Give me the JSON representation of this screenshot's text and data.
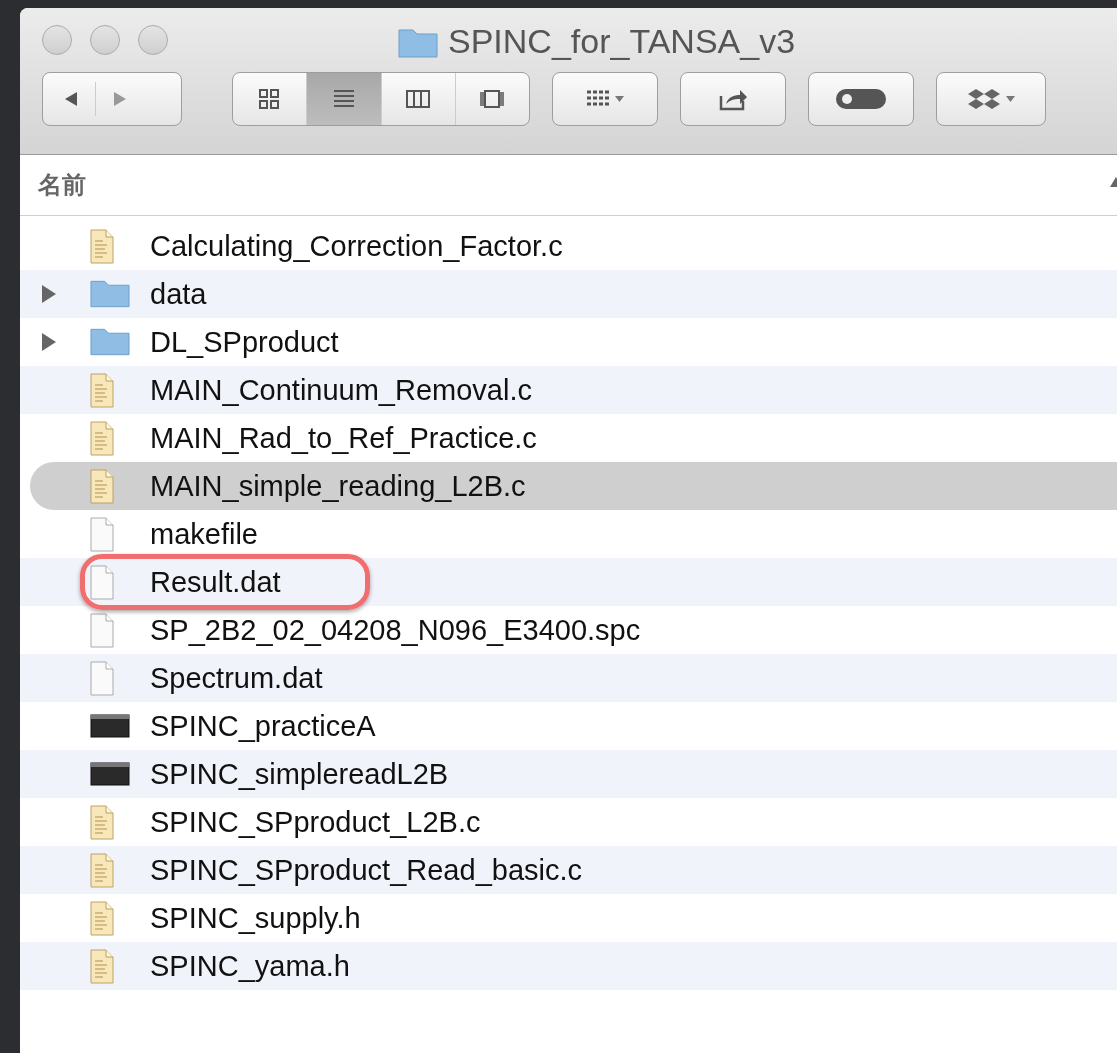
{
  "window": {
    "title": "SPINC_for_TANSA_v3"
  },
  "toolbar": {
    "view_modes": [
      {
        "kind": "icons",
        "selected": false
      },
      {
        "kind": "list",
        "selected": true
      },
      {
        "kind": "columns",
        "selected": false
      },
      {
        "kind": "coverflow",
        "selected": false
      }
    ]
  },
  "column_header": {
    "label": "名前"
  },
  "files": [
    {
      "name": "Calculating_Correction_Factor.c",
      "kind": "source",
      "selected": false
    },
    {
      "name": "data",
      "kind": "folder",
      "expanded": false,
      "selected": false
    },
    {
      "name": "DL_SPproduct",
      "kind": "folder",
      "expanded": false,
      "selected": false
    },
    {
      "name": "MAIN_Continuum_Removal.c",
      "kind": "source",
      "selected": false
    },
    {
      "name": "MAIN_Rad_to_Ref_Practice.c",
      "kind": "source",
      "selected": false
    },
    {
      "name": "MAIN_simple_reading_L2B.c",
      "kind": "source",
      "selected": true
    },
    {
      "name": "makefile",
      "kind": "plain",
      "selected": false
    },
    {
      "name": "Result.dat",
      "kind": "plain",
      "selected": false,
      "circled": true
    },
    {
      "name": "SP_2B2_02_04208_N096_E3400.spc",
      "kind": "plain",
      "selected": false
    },
    {
      "name": "Spectrum.dat",
      "kind": "plain",
      "selected": false
    },
    {
      "name": "SPINC_practiceA",
      "kind": "exec",
      "selected": false
    },
    {
      "name": "SPINC_simplereadL2B",
      "kind": "exec",
      "selected": false
    },
    {
      "name": "SPINC_SPproduct_L2B.c",
      "kind": "source",
      "selected": false
    },
    {
      "name": "SPINC_SPproduct_Read_basic.c",
      "kind": "source",
      "selected": false
    },
    {
      "name": "SPINC_supply.h",
      "kind": "source",
      "selected": false
    },
    {
      "name": "SPINC_yama.h",
      "kind": "source",
      "selected": false
    }
  ]
}
